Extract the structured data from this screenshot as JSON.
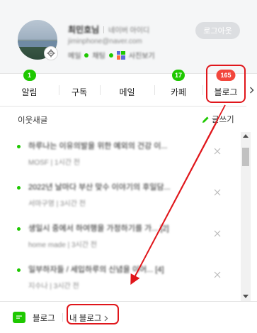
{
  "profile": {
    "name": "최민호님",
    "name_extra": "네이버 아이디",
    "email": "jiminphone@naver.com",
    "mini_items": [
      "메일",
      "채팅",
      "사진보기"
    ],
    "logout_label": "로그아웃"
  },
  "tabs": [
    {
      "label": "알림",
      "badge": "1"
    },
    {
      "label": "구독",
      "badge": ""
    },
    {
      "label": "메일",
      "badge": ""
    },
    {
      "label": "카페",
      "badge": "17"
    },
    {
      "label": "블로그",
      "badge": "165"
    }
  ],
  "feed": {
    "title": "이웃새글",
    "write_label": "글쓰기",
    "items": [
      {
        "title": "하루나는 이유의발을 위한 예외의 건강 이...",
        "meta": "MOSF  |  1시간 전"
      },
      {
        "title": "2022년 날마다 부산 맞수 이야기의 후일담...",
        "meta": "서마구영  |  3시간 전"
      },
      {
        "title": "생일시 중에서 하여행을 가정하기를 가... [2]",
        "meta": "home made  |  3시간 전"
      },
      {
        "title": "일부하자들 / 세입하루의 신념을 이어... [4]",
        "meta": "지수나  |  3시간 전"
      }
    ]
  },
  "footer": {
    "service_label": "블로그",
    "my_blog_label": "내 블로그"
  },
  "colors": {
    "naver_green": "#1ec800",
    "badge_red": "#f2463c",
    "highlight_red": "#e0161b"
  }
}
